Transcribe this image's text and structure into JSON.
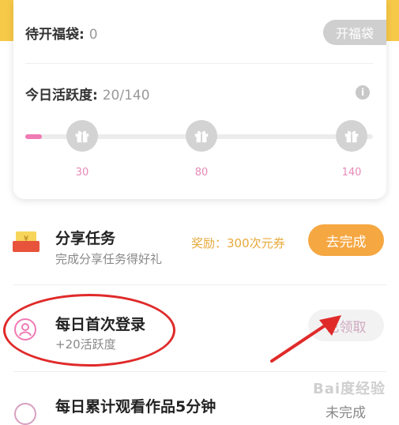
{
  "lucky_bag": {
    "label": "待开福袋: ",
    "count": "0",
    "open_button": "开福袋"
  },
  "activity": {
    "label": "今日活跃度: ",
    "value": "20/140",
    "info_icon": "i",
    "progress": {
      "current": 20,
      "max": 140
    },
    "milestones": [
      {
        "value": "30",
        "icon": "gift-icon"
      },
      {
        "value": "80",
        "icon": "gift-icon"
      },
      {
        "value": "140",
        "icon": "gift-icon"
      }
    ]
  },
  "tasks": [
    {
      "title": "分享任务",
      "subtitle": "完成分享任务得好礼",
      "reward": "奖励：300次元券",
      "action": "去完成",
      "icon": "coupon-icon"
    },
    {
      "title": "每日首次登录",
      "subtitle": "+20活跃度",
      "action": "已领取",
      "icon": "user-icon"
    },
    {
      "title": "每日累计观看作品5分钟",
      "action": "未完成",
      "icon": "clock-icon"
    }
  ],
  "watermark": "Bai度经验",
  "colors": {
    "accent_yellow": "#f7c948",
    "progress_pink": "#f07ab4",
    "button_orange": "#f5a742",
    "annotation_red": "#e02a2a"
  }
}
